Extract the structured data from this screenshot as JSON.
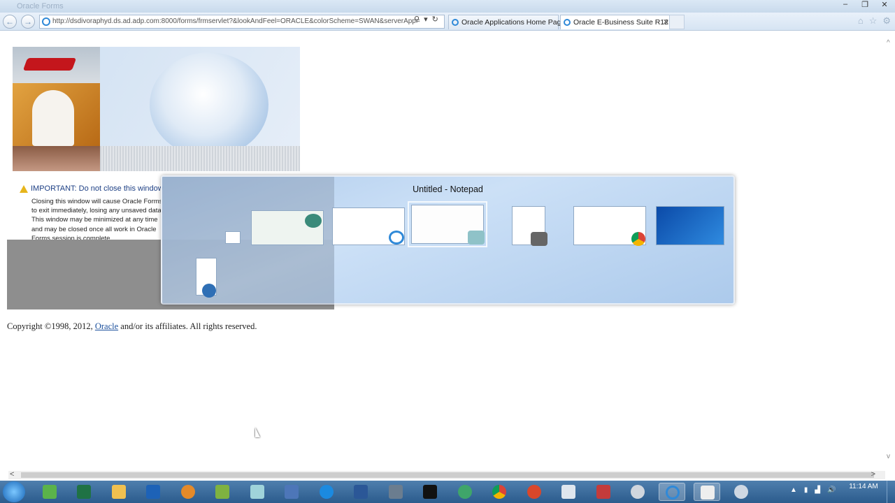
{
  "window": {
    "title": "Oracle Forms",
    "controls": [
      "–",
      "❐",
      "✕"
    ]
  },
  "browser": {
    "address": "http://dsdivoraphyd.ds.ad.adp.com:8000/forms/frmservlet?&lookAndFeel=ORACLE&colorScheme=SWAN&serverApp=",
    "search_icon": "⚲",
    "dropdown_icon": "▾",
    "refresh_icon": "↻",
    "back_icon": "←",
    "forward_icon": "→",
    "tabs": [
      {
        "label": "Oracle Applications Home Page"
      },
      {
        "label": "Oracle E-Business Suite R12"
      }
    ],
    "tab_close": "✕",
    "home_icon": "⌂",
    "favorites_icon": "☆",
    "tools_icon": "⚙"
  },
  "page": {
    "warning_title": "IMPORTANT: Do not close this window",
    "warning_body": "Closing this window will cause Oracle Forms to exit immediately, losing any unsaved data. This window may be minimized at any time and may be closed once all work in Oracle Forms session is complete.",
    "copyright_prefix": "Copyright ©1998, 2012,",
    "copyright_link": "Oracle",
    "copyright_suffix": "and/or its affiliates. All rights reserved."
  },
  "switcher": {
    "title": "Untitled - Notepad"
  },
  "scrollbars": {
    "left": "<",
    "right": ">",
    "up": "^",
    "down": "v"
  },
  "taskbar": {
    "clock_time": "11:14 AM",
    "tray_arrow": "▲",
    "volume_icon": "🔊"
  },
  "colors": {
    "accent": "#2f89d8",
    "taskbar": "#2b5b8c",
    "link": "#1a4f9c"
  }
}
